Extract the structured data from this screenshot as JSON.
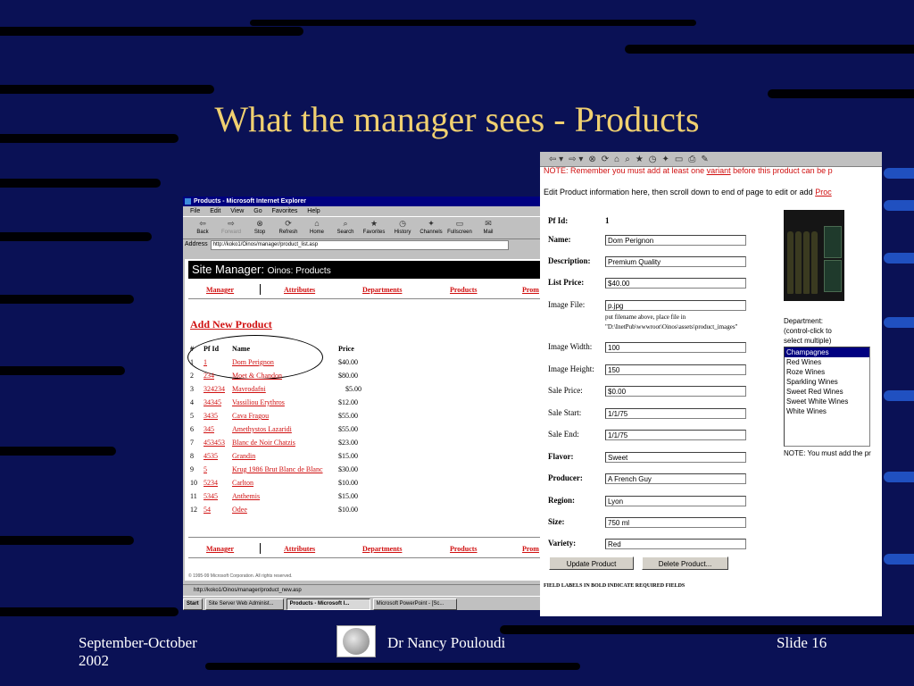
{
  "slide": {
    "title": "What the manager sees - Products",
    "footer_left": "September-October 2002",
    "footer_center": "Dr Nancy Pouloudi",
    "footer_right": "Slide 16"
  },
  "list_window": {
    "title": "Products - Microsoft Internet Explorer",
    "menu": [
      "File",
      "Edit",
      "View",
      "Go",
      "Favorites",
      "Help"
    ],
    "toolbar": [
      {
        "label": "Back",
        "icon": "back-arrow-icon",
        "glyph": "⇦"
      },
      {
        "label": "Forward",
        "icon": "forward-arrow-icon",
        "glyph": "⇨"
      },
      {
        "label": "Stop",
        "icon": "stop-icon",
        "glyph": "⊗"
      },
      {
        "label": "Refresh",
        "icon": "refresh-icon",
        "glyph": "⟳"
      },
      {
        "label": "Home",
        "icon": "home-icon",
        "glyph": "⌂"
      },
      {
        "label": "Search",
        "icon": "search-icon",
        "glyph": "⌕"
      },
      {
        "label": "Favorites",
        "icon": "favorites-icon",
        "glyph": "★"
      },
      {
        "label": "History",
        "icon": "history-icon",
        "glyph": "◷"
      },
      {
        "label": "Channels",
        "icon": "channels-icon",
        "glyph": "✦"
      },
      {
        "label": "Fullscreen",
        "icon": "fullscreen-icon",
        "glyph": "▭"
      },
      {
        "label": "Mail",
        "icon": "mail-icon",
        "glyph": "✉"
      }
    ],
    "address_label": "Address",
    "address_url": "http://koko1/Oinos/manager/product_list.asp",
    "site_manager": "Site Manager:",
    "site_sub": "Oinos: Products",
    "nav": [
      "Manager",
      "Attributes",
      "Departments",
      "Products",
      "Prom"
    ],
    "add_new": "Add New Product",
    "columns": [
      "#",
      "Pf Id",
      "Name",
      "Price"
    ],
    "products": [
      {
        "n": "1",
        "id": "1",
        "name": "Dom Perignon",
        "price": "$40.00"
      },
      {
        "n": "2",
        "id": "234",
        "name": "Moet & Chandon",
        "price": "$80.00"
      },
      {
        "n": "3",
        "id": "324234",
        "name": "Mavrodafni",
        "price": "$5.00"
      },
      {
        "n": "4",
        "id": "34345",
        "name": "Vassiliou Erythros",
        "price": "$12.00"
      },
      {
        "n": "5",
        "id": "3435",
        "name": "Cava Fragou",
        "price": "$55.00"
      },
      {
        "n": "6",
        "id": "345",
        "name": "Amethystos Lazaridi",
        "price": "$55.00"
      },
      {
        "n": "7",
        "id": "453453",
        "name": "Blanc de Noir Chatzis",
        "price": "$23.00"
      },
      {
        "n": "8",
        "id": "4535",
        "name": "Grandin",
        "price": "$15.00"
      },
      {
        "n": "9",
        "id": "5",
        "name": "Krug 1986 Brut Blanc de Blanc",
        "price": "$30.00"
      },
      {
        "n": "10",
        "id": "5234",
        "name": "Carlton",
        "price": "$10.00"
      },
      {
        "n": "11",
        "id": "5345",
        "name": "Anthemis",
        "price": "$15.00"
      },
      {
        "n": "12",
        "id": "54",
        "name": "Odee",
        "price": "$10.00"
      }
    ],
    "copyright": "© 1995-99 Microsoft Corporation. All rights reserved.",
    "status_url": "http://koko1/Oinos/manager/product_new.asp",
    "taskbar": [
      "Start",
      "Site Server Web Administ...",
      "Products - Microsoft I...",
      "Microsoft PowerPoint - [Sc..."
    ]
  },
  "edit_window": {
    "toolbar_glyphs": [
      "⇦ ▾",
      "⇨ ▾",
      "⊗",
      "⟳",
      "⌂",
      "⌕",
      "★",
      "◷",
      "✦",
      "▭",
      "⎙",
      "✎"
    ],
    "note_prefix": "NOTE: Remember you must add at least one ",
    "note_link": "variant",
    "note_suffix": " before this product can be p",
    "intro_prefix": "Edit Product information here, then scroll down to end of page to edit or add ",
    "intro_link": "Proc",
    "pf_id_label": "Pf Id:",
    "pf_id_value": "1",
    "fields": [
      {
        "label": "Name:",
        "value": "Dom Perignon",
        "required": true
      },
      {
        "label": "Description:",
        "value": "Premium Quality",
        "required": true
      },
      {
        "label": "List Price:",
        "value": "$40.00",
        "required": true
      },
      {
        "label": "Image File:",
        "value": "p.jpg",
        "required": false
      },
      {
        "label": "Image Width:",
        "value": "100",
        "required": false
      },
      {
        "label": "Image Height:",
        "value": "150",
        "required": false
      },
      {
        "label": "Sale Price:",
        "value": "$0.00",
        "required": false
      },
      {
        "label": "Sale Start:",
        "value": "1/1/75",
        "required": false
      },
      {
        "label": "Sale End:",
        "value": "1/1/75",
        "required": false
      },
      {
        "label": "Flavor:",
        "value": "Sweet",
        "required": true
      },
      {
        "label": "Producer:",
        "value": "A French Guy",
        "required": true
      },
      {
        "label": "Region:",
        "value": "Lyon",
        "required": true
      },
      {
        "label": "Size:",
        "value": "750 ml",
        "required": true
      },
      {
        "label": "Variety:",
        "value": "Red",
        "required": true
      }
    ],
    "image_hint_1": "put filename above, place file in",
    "image_hint_2": "\"D:\\InetPub\\wwwroot\\Oinos\\assets\\product_images\"",
    "department_label": "Department:\n(control-click to\nselect multiple)",
    "departments": [
      "Champagnes",
      "Red Wines",
      "Roze Wines",
      "Sparkling Wines",
      "Sweet Red Wines",
      "Sweet White Wines",
      "White Wines"
    ],
    "department_selected": "Champagnes",
    "department_note": "NOTE: You must add the pr",
    "update_button": "Update Product",
    "delete_button": "Delete Product...",
    "footnote": "FIELD LABELS IN BOLD INDICATE REQUIRED FIELDS"
  }
}
